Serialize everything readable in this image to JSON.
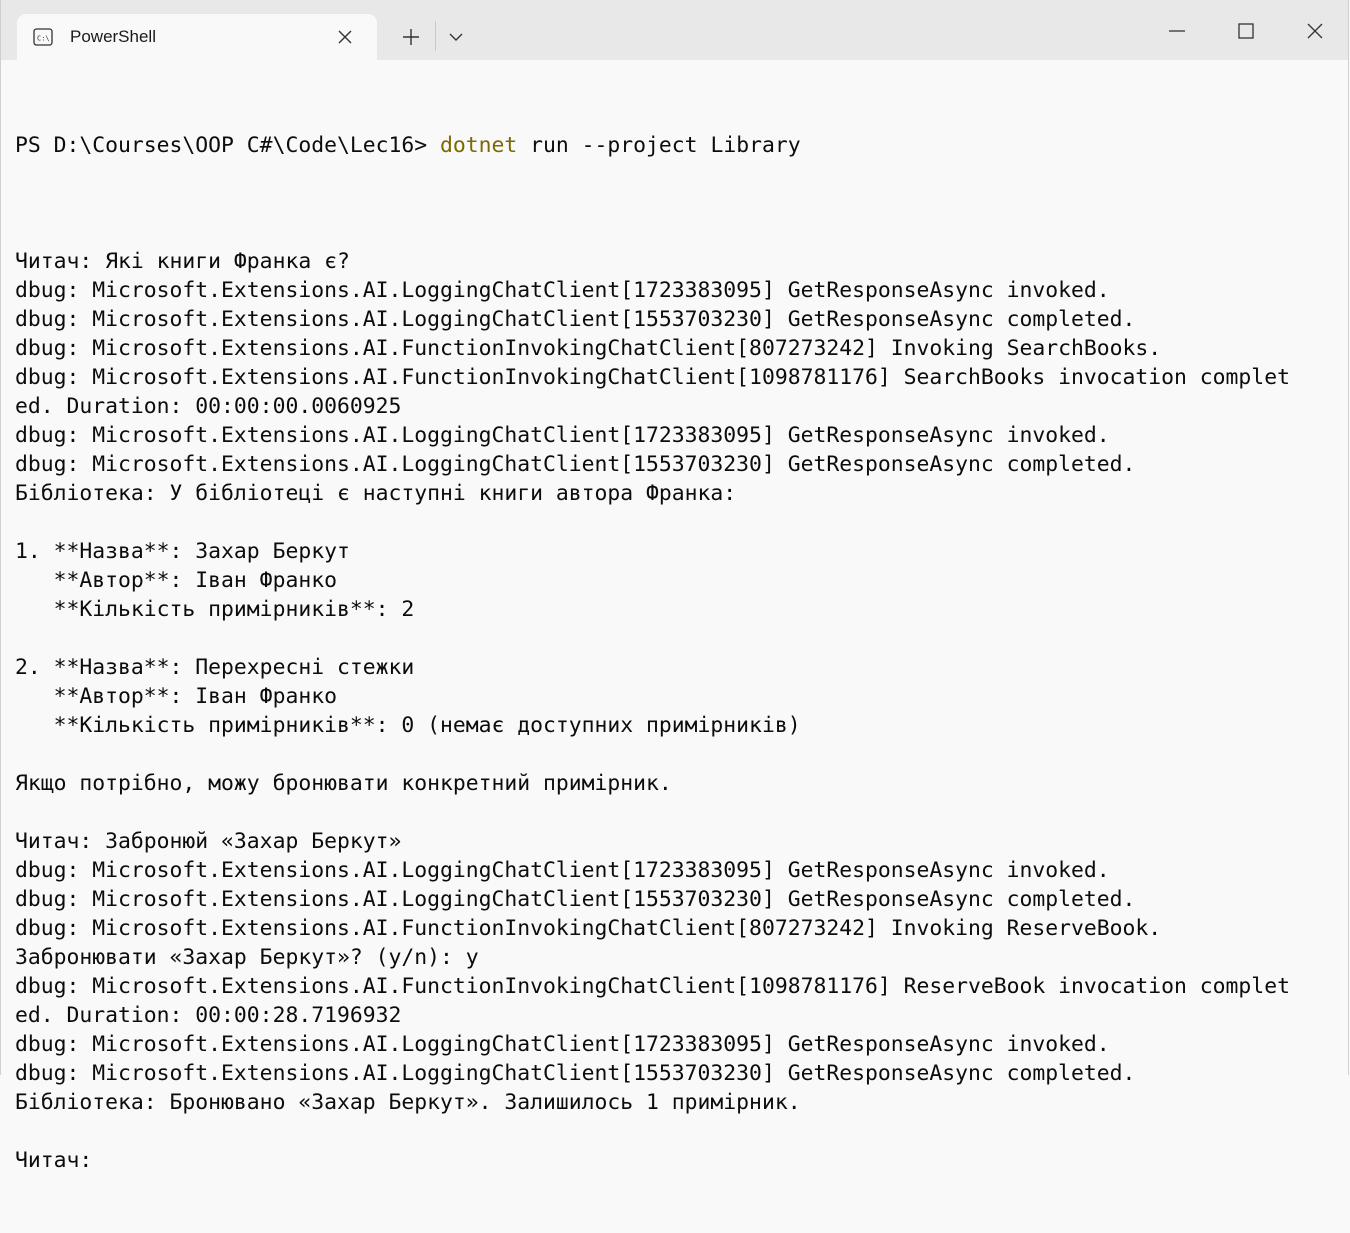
{
  "window": {
    "tab_title": "PowerShell",
    "tab_icon": "terminal-icon",
    "new_tab_icon": "plus-icon",
    "dropdown_icon": "chevron-down-icon",
    "minimize_icon": "minimize-icon",
    "maximize_icon": "maximize-icon",
    "close_icon": "close-icon"
  },
  "colors": {
    "background": "#f9f9f9",
    "titlebar": "#e8e8e8",
    "text": "#0c0c0c",
    "command": "#7a6a00"
  },
  "terminal": {
    "prompt": "PS D:\\Courses\\OOP C#\\Code\\Lec16> ",
    "command": "dotnet",
    "args": " run --project Library",
    "lines": [
      "",
      "Читач: Які книги Франка є?",
      "dbug: Microsoft.Extensions.AI.LoggingChatClient[1723383095] GetResponseAsync invoked.",
      "dbug: Microsoft.Extensions.AI.LoggingChatClient[1553703230] GetResponseAsync completed.",
      "dbug: Microsoft.Extensions.AI.FunctionInvokingChatClient[807273242] Invoking SearchBooks.",
      "dbug: Microsoft.Extensions.AI.FunctionInvokingChatClient[1098781176] SearchBooks invocation complet",
      "ed. Duration: 00:00:00.0060925",
      "dbug: Microsoft.Extensions.AI.LoggingChatClient[1723383095] GetResponseAsync invoked.",
      "dbug: Microsoft.Extensions.AI.LoggingChatClient[1553703230] GetResponseAsync completed.",
      "Бібліотека: У бібліотеці є наступні книги автора Франка:",
      "",
      "1. **Назва**: Захар Беркут",
      "   **Автор**: Іван Франко",
      "   **Кількість примірників**: 2",
      "",
      "2. **Назва**: Перехресні стежки",
      "   **Автор**: Іван Франко",
      "   **Кількість примірників**: 0 (немає доступних примірників)",
      "",
      "Якщо потрібно, можу бронювати конкретний примірник.",
      "",
      "Читач: Забронюй «Захар Беркут»",
      "dbug: Microsoft.Extensions.AI.LoggingChatClient[1723383095] GetResponseAsync invoked.",
      "dbug: Microsoft.Extensions.AI.LoggingChatClient[1553703230] GetResponseAsync completed.",
      "dbug: Microsoft.Extensions.AI.FunctionInvokingChatClient[807273242] Invoking ReserveBook.",
      "Забронювати «Захар Беркут»? (y/n): y",
      "dbug: Microsoft.Extensions.AI.FunctionInvokingChatClient[1098781176] ReserveBook invocation complet",
      "ed. Duration: 00:00:28.7196932",
      "dbug: Microsoft.Extensions.AI.LoggingChatClient[1723383095] GetResponseAsync invoked.",
      "dbug: Microsoft.Extensions.AI.LoggingChatClient[1553703230] GetResponseAsync completed.",
      "Бібліотека: Бронювано «Захар Беркут». Залишилось 1 примірник.",
      "",
      "Читач:"
    ]
  }
}
